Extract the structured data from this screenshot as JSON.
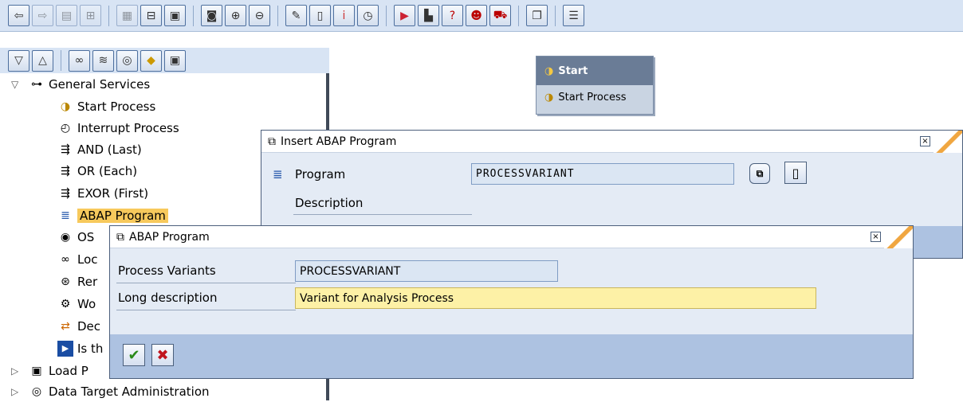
{
  "toolbar": {
    "buttons": [
      "back-arrow-icon",
      "forward-arrow-icon",
      "window-icon",
      "tree-icon",
      "layout-icon",
      "hierarchy-icon",
      "scroll-icon",
      "refresh-icon",
      "zoom-in-icon",
      "zoom-out-icon",
      "wand-icon",
      "new-page-icon",
      "info-icon",
      "clock-icon",
      "execute-icon",
      "chart-icon",
      "help-icon",
      "user-icon",
      "transport-icon",
      "copy-icon",
      "list-icon"
    ]
  },
  "tree": {
    "group_general": "General Services",
    "items": [
      {
        "label": "Start Process",
        "icon": "start-process-icon"
      },
      {
        "label": "Interrupt Process",
        "icon": "interrupt-process-icon"
      },
      {
        "label": "AND (Last)",
        "icon": "and-icon"
      },
      {
        "label": "OR (Each)",
        "icon": "or-icon"
      },
      {
        "label": "EXOR (First)",
        "icon": "exor-icon"
      },
      {
        "label": "ABAP Program",
        "icon": "abap-program-icon"
      },
      {
        "label": "OS",
        "icon": "os-command-icon"
      },
      {
        "label": "Loc",
        "icon": "local-chain-icon"
      },
      {
        "label": "Rer",
        "icon": "remote-chain-icon"
      },
      {
        "label": "Wo",
        "icon": "workflow-icon"
      },
      {
        "label": "Dec",
        "icon": "decision-icon"
      },
      {
        "label": "Is th",
        "icon": "is-there-icon"
      }
    ],
    "group_load": "Load P",
    "group_data_target": "Data Target Administration"
  },
  "start_node": {
    "title": "Start",
    "subtitle": "Start Process"
  },
  "insert_dialog": {
    "title": "Insert ABAP Program",
    "program_label": "Program",
    "program_value": "PROCESSVARIANT",
    "description_label": "Description"
  },
  "abap_dialog": {
    "title": "ABAP Program",
    "process_variants_label": "Process Variants",
    "process_variants_value": "PROCESSVARIANT",
    "long_description_label": "Long description",
    "long_description_value": "Variant for Analysis Process"
  },
  "colors": {
    "toolbar_bg": "#d8e4f4",
    "selection": "#f7c95c",
    "yellow_field": "#fdf1a6",
    "dialog_footer": "#adc2e1",
    "accent_orange": "#f0a640"
  }
}
